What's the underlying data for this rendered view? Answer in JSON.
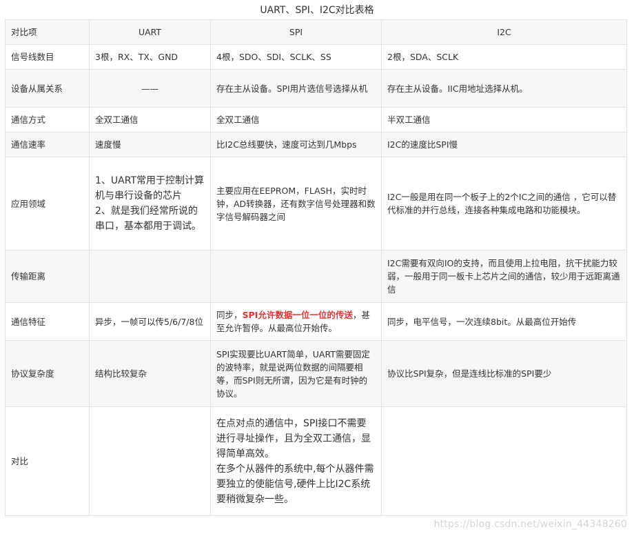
{
  "caption": "UART、SPI、I2C对比表格",
  "header": [
    "对比项",
    "UART",
    "SPI",
    "I2C"
  ],
  "rows": [
    {
      "label": "信号线数目",
      "uart": "3根，RX、TX、GND",
      "spi": "4根，SDO、SDI、SCLK、SS",
      "i2c": "2根，SDA、SCLK"
    },
    {
      "label": "设备从属关系",
      "uart": "——",
      "spi": "存在主从设备。SPI用片选信号选择从机",
      "i2c": "存在主从设备。IIC用地址选择从机。"
    },
    {
      "label": "通信方式",
      "uart": "全双工通信",
      "spi": "全双工通信",
      "i2c": "半双工通信"
    },
    {
      "label": "通信速率",
      "uart": "速度慢",
      "spi": "比I2C总线要快，速度可达到几Mbps",
      "i2c": "I2C的速度比SPI慢"
    },
    {
      "label": "应用领域",
      "uart_1": "1、UART常用于控制计算机与串行设备的芯片",
      "uart_2": "2、就是我们经常所说的串口，基本都用于调试。",
      "spi": "主要应用在EEPROM，FLASH，实时时钟，AD转换器，还有数字信号处理器和数字信号解码器之间",
      "i2c": "I2C一般是用在同一个板子上的2个IC之间的通信 ，它可以替代标准的并行总线，连接各种集成电路和功能模块。"
    },
    {
      "label": "传输距离",
      "uart": "",
      "spi": "",
      "i2c": "I2C需要有双向IO的支持，而且使用上拉电阻，抗干扰能力较弱，一般用于同一板卡上芯片之间的通信，较少用于远距离通信"
    },
    {
      "label": "通信特征",
      "uart": "异步，一帧可以传5/6/7/8位",
      "spi_pre": "同步，",
      "spi_hl": "SPI允许数据一位一位的传送",
      "spi_post": "，甚至允许暂停。从最高位开始传。",
      "i2c": "同步，电平信号，一次连续8bit。从最高位开始传"
    },
    {
      "label": "协议复杂度",
      "uart": "结构比较复杂",
      "spi": "SPI实现要比UART简单，UART需要固定的波特率，就是说两位数据的间隔要相等，而SPI则无所谓，因为它是有时钟的协议。",
      "i2c": "协议比SPI复杂，但是连线比标准的SPI要少"
    },
    {
      "label": "对比",
      "uart": "",
      "spi_1": "在点对点的通信中，SPI接口不需要进行寻址操作，且为全双工通信，显得简单高效。",
      "spi_2": "在多个从器件的系统中,每个从器件需要独立的使能信号,硬件上比I2C系统要稍微复杂一些。",
      "i2c": ""
    }
  ],
  "watermark": "https://blog.csdn.net/weixin_44348260"
}
